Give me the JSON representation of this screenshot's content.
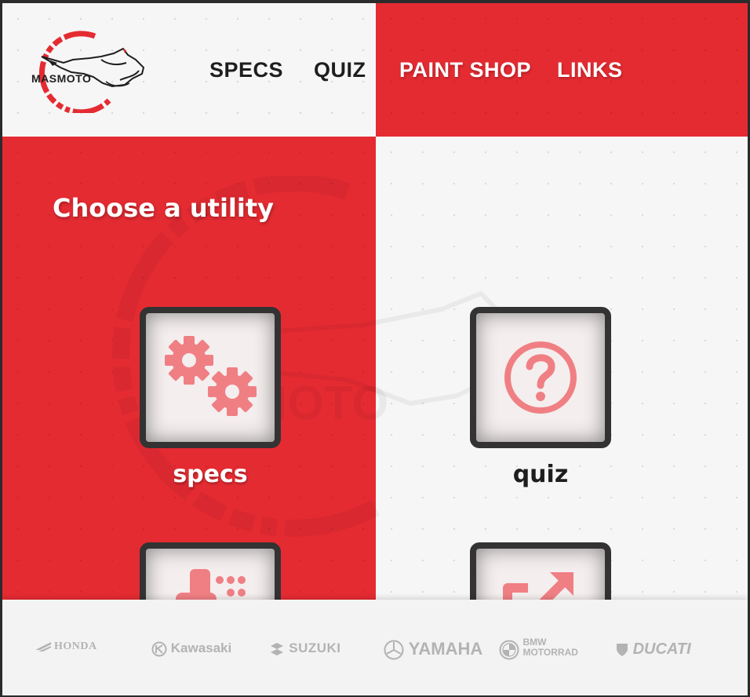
{
  "logo": {
    "text": "MASMOTO"
  },
  "nav": {
    "specs": "SPECS",
    "quiz": "QUIZ",
    "paint_shop": "PAINT SHOP",
    "links": "LINKS"
  },
  "main": {
    "heading": "Choose a utility",
    "watermark_text": "MASMOTO",
    "tiles": [
      {
        "label": "specs",
        "icon": "gears-icon"
      },
      {
        "label": "quiz",
        "icon": "question-circle-icon"
      },
      {
        "label": "",
        "icon": "paint-palette-icon"
      },
      {
        "label": "",
        "icon": "external-link-icon"
      }
    ]
  },
  "footer": {
    "brands": [
      "HONDA",
      "Kawasaki",
      "SUZUKI",
      "YAMAHA",
      "BMW",
      "MOTORRAD",
      "DUCATI"
    ]
  },
  "colors": {
    "accent_red": "#e52b32",
    "icon_pink": "#f07f84",
    "dark": "#1e1e1e",
    "tile_border": "#333333",
    "background": "#f6f6f6",
    "brand_grey": "#b3b3b3"
  }
}
